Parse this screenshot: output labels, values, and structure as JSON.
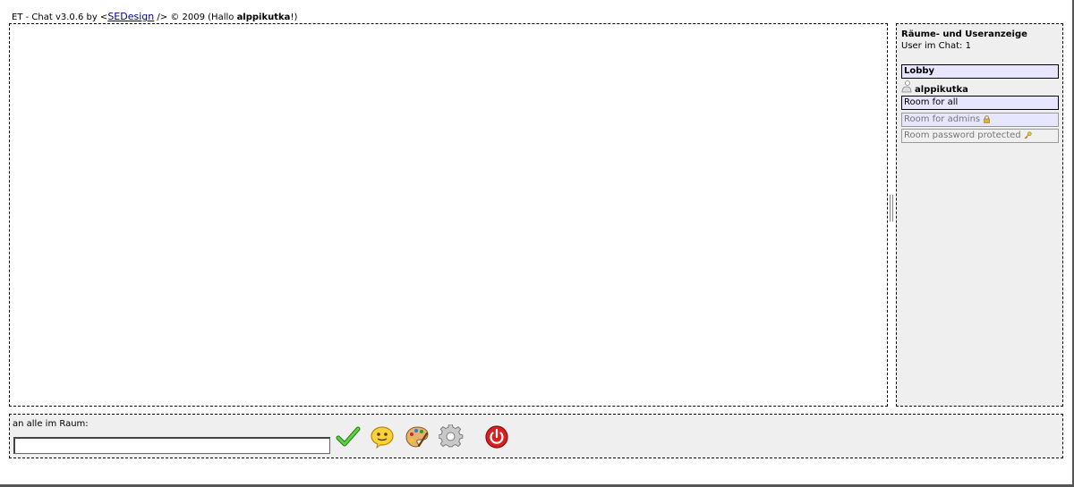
{
  "header": {
    "prefix": "ET - Chat v3.0.6 by <",
    "link_text": "SEDesign",
    "suffix": " /> © 2009 (Hallo ",
    "username": "alppikutka",
    "end": "!)"
  },
  "sidebar": {
    "title": "Räume- und Useranzeige",
    "user_count": "User im Chat: 1",
    "rooms": [
      {
        "label": "Lobby",
        "icon": ""
      },
      {
        "label": "Room for all",
        "icon": ""
      },
      {
        "label": "Room for admins",
        "icon": "lock-icon"
      },
      {
        "label": "Room password protected",
        "icon": "key-icon"
      }
    ],
    "users": [
      {
        "name": "alppikutka",
        "icon": "user-icon"
      }
    ]
  },
  "input_bar": {
    "label": "an alle im Raum:",
    "message_value": "",
    "tools": [
      {
        "name": "send-icon",
        "color": "#2e9e1f"
      },
      {
        "name": "smiley-icon",
        "color": "#f4c20d"
      },
      {
        "name": "palette-icon",
        "color": "#c8843c"
      },
      {
        "name": "settings-gear-icon",
        "color": "#9a9a9a"
      },
      {
        "name": "power-icon",
        "color": "#d21f1f"
      }
    ]
  }
}
